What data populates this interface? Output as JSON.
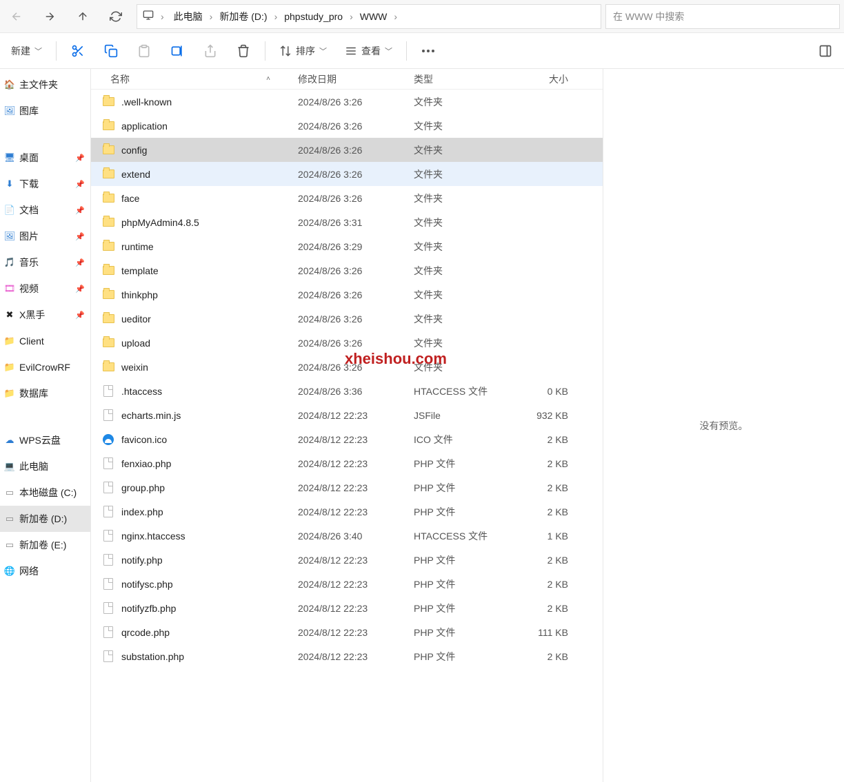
{
  "nav": {
    "breadcrumb": [
      "此电脑",
      "新加卷 (D:)",
      "phpstudy_pro",
      "WWW"
    ],
    "search_placeholder": "在 WWW 中搜索"
  },
  "toolbar": {
    "new_label": "新建",
    "sort_label": "排序",
    "view_label": "查看"
  },
  "sidebar": {
    "groups": [
      [
        {
          "label": "主文件夹",
          "icon": "home",
          "color": "#f5b042"
        },
        {
          "label": "图库",
          "icon": "gallery",
          "color": "#2d7dd2"
        }
      ],
      [
        {
          "label": "桌面",
          "icon": "desktop",
          "color": "#2d7dd2",
          "pin": true
        },
        {
          "label": "下载",
          "icon": "download",
          "color": "#2d7dd2",
          "pin": true
        },
        {
          "label": "文档",
          "icon": "doc",
          "color": "#2d7dd2",
          "pin": true
        },
        {
          "label": "图片",
          "icon": "picture",
          "color": "#2d7dd2",
          "pin": true
        },
        {
          "label": "音乐",
          "icon": "music",
          "color": "#e64ac9",
          "pin": true
        },
        {
          "label": "视频",
          "icon": "video",
          "color": "#e64ac9",
          "pin": true
        },
        {
          "label": "X黑手",
          "icon": "x",
          "color": "#222",
          "pin": true
        },
        {
          "label": "Client",
          "icon": "folder",
          "color": "#e8c14d"
        },
        {
          "label": "EvilCrowRF",
          "icon": "folder",
          "color": "#e8c14d"
        },
        {
          "label": "数据库",
          "icon": "folder",
          "color": "#e8c14d"
        }
      ],
      [
        {
          "label": "WPS云盘",
          "icon": "cloud",
          "color": "#2d7dd2"
        },
        {
          "label": "此电脑",
          "icon": "pc",
          "color": "#2d7dd2"
        },
        {
          "label": "本地磁盘 (C:)",
          "icon": "disk",
          "color": "#888"
        },
        {
          "label": "新加卷 (D:)",
          "icon": "disk",
          "color": "#888",
          "selected": true
        },
        {
          "label": "新加卷 (E:)",
          "icon": "disk",
          "color": "#888"
        },
        {
          "label": "网络",
          "icon": "net",
          "color": "#2d7dd2"
        }
      ]
    ]
  },
  "columns": {
    "name": "名称",
    "date": "修改日期",
    "type": "类型",
    "size": "大小"
  },
  "files": [
    {
      "icon": "folder",
      "name": ".well-known",
      "date": "2024/8/26 3:26",
      "type": "文件夹",
      "size": ""
    },
    {
      "icon": "folder",
      "name": "application",
      "date": "2024/8/26 3:26",
      "type": "文件夹",
      "size": ""
    },
    {
      "icon": "folder",
      "name": "config",
      "date": "2024/8/26 3:26",
      "type": "文件夹",
      "size": "",
      "state": "selected"
    },
    {
      "icon": "folder",
      "name": "extend",
      "date": "2024/8/26 3:26",
      "type": "文件夹",
      "size": "",
      "state": "hover"
    },
    {
      "icon": "folder",
      "name": "face",
      "date": "2024/8/26 3:26",
      "type": "文件夹",
      "size": ""
    },
    {
      "icon": "folder",
      "name": "phpMyAdmin4.8.5",
      "date": "2024/8/26 3:31",
      "type": "文件夹",
      "size": ""
    },
    {
      "icon": "folder",
      "name": "runtime",
      "date": "2024/8/26 3:29",
      "type": "文件夹",
      "size": ""
    },
    {
      "icon": "folder",
      "name": "template",
      "date": "2024/8/26 3:26",
      "type": "文件夹",
      "size": ""
    },
    {
      "icon": "folder",
      "name": "thinkphp",
      "date": "2024/8/26 3:26",
      "type": "文件夹",
      "size": ""
    },
    {
      "icon": "folder",
      "name": "ueditor",
      "date": "2024/8/26 3:26",
      "type": "文件夹",
      "size": ""
    },
    {
      "icon": "folder",
      "name": "upload",
      "date": "2024/8/26 3:26",
      "type": "文件夹",
      "size": ""
    },
    {
      "icon": "folder",
      "name": "weixin",
      "date": "2024/8/26 3:26",
      "type": "文件夹",
      "size": ""
    },
    {
      "icon": "file",
      "name": ".htaccess",
      "date": "2024/8/26 3:36",
      "type": "HTACCESS 文件",
      "size": "0 KB"
    },
    {
      "icon": "file",
      "name": "echarts.min.js",
      "date": "2024/8/12 22:23",
      "type": "JSFile",
      "size": "932 KB"
    },
    {
      "icon": "ico",
      "name": "favicon.ico",
      "date": "2024/8/12 22:23",
      "type": "ICO 文件",
      "size": "2 KB"
    },
    {
      "icon": "file",
      "name": "fenxiao.php",
      "date": "2024/8/12 22:23",
      "type": "PHP 文件",
      "size": "2 KB"
    },
    {
      "icon": "file",
      "name": "group.php",
      "date": "2024/8/12 22:23",
      "type": "PHP 文件",
      "size": "2 KB"
    },
    {
      "icon": "file",
      "name": "index.php",
      "date": "2024/8/12 22:23",
      "type": "PHP 文件",
      "size": "2 KB"
    },
    {
      "icon": "file",
      "name": "nginx.htaccess",
      "date": "2024/8/26 3:40",
      "type": "HTACCESS 文件",
      "size": "1 KB"
    },
    {
      "icon": "file",
      "name": "notify.php",
      "date": "2024/8/12 22:23",
      "type": "PHP 文件",
      "size": "2 KB"
    },
    {
      "icon": "file",
      "name": "notifysc.php",
      "date": "2024/8/12 22:23",
      "type": "PHP 文件",
      "size": "2 KB"
    },
    {
      "icon": "file",
      "name": "notifyzfb.php",
      "date": "2024/8/12 22:23",
      "type": "PHP 文件",
      "size": "2 KB"
    },
    {
      "icon": "file",
      "name": "qrcode.php",
      "date": "2024/8/12 22:23",
      "type": "PHP 文件",
      "size": "111 KB"
    },
    {
      "icon": "file",
      "name": "substation.php",
      "date": "2024/8/12 22:23",
      "type": "PHP 文件",
      "size": "2 KB"
    }
  ],
  "preview": {
    "empty_text": "没有预览。"
  },
  "watermark": "xheishou.com"
}
